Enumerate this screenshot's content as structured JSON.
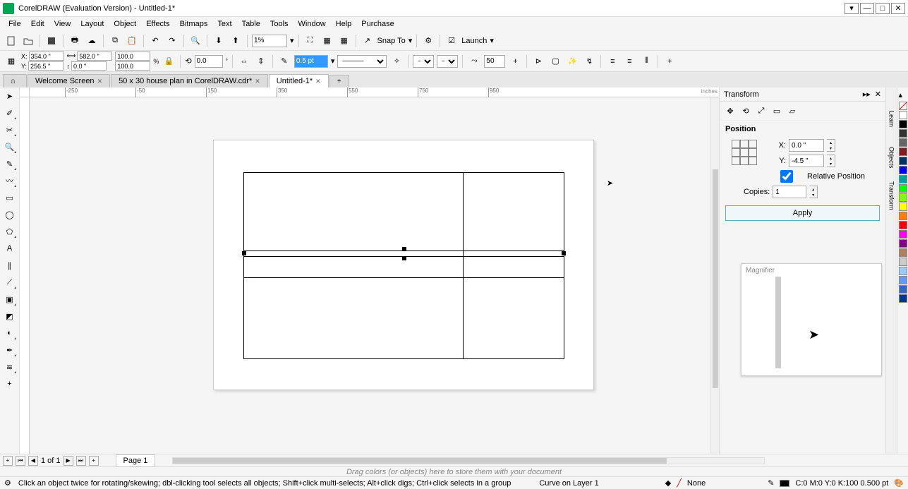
{
  "title": "CorelDRAW (Evaluation Version) - Untitled-1*",
  "menu": [
    "File",
    "Edit",
    "View",
    "Layout",
    "Object",
    "Effects",
    "Bitmaps",
    "Text",
    "Table",
    "Tools",
    "Window",
    "Help",
    "Purchase"
  ],
  "toolbar": {
    "zoom": "1%",
    "snap": "Snap To",
    "launch": "Launch"
  },
  "propbar": {
    "x": "354.0 \"",
    "y": "256.5 \"",
    "w": "582.0 \"",
    "h": "0.0 \"",
    "sx": "100.0",
    "sy": "100.0",
    "rot": "0.0",
    "outline": "0.5 pt",
    "arrow": "50"
  },
  "tabs": [
    {
      "label": "Welcome Screen",
      "active": false
    },
    {
      "label": "50 x 30 house plan in CorelDRAW.cdr*",
      "active": false
    },
    {
      "label": "Untitled-1*",
      "active": true
    }
  ],
  "ruler_h": [
    "-250",
    "-50",
    "150",
    "350",
    "550",
    "750",
    "950"
  ],
  "ruler_h_positions": [
    90,
    190,
    290,
    390,
    490,
    590,
    690
  ],
  "ruler_units": "inches",
  "transform": {
    "title": "Transform",
    "section": "Position",
    "x": "0.0 \"",
    "y": "-4.5 \"",
    "relative": "Relative Position",
    "copies_label": "Copies:",
    "copies": "1",
    "apply": "Apply"
  },
  "magnifier_title": "Magnifier",
  "docker_tabs": [
    "Learn",
    "Objects",
    "Transform"
  ],
  "colors": [
    "#ffffff",
    "#000000",
    "#333333",
    "#666666",
    "#7f1f1f",
    "#003366",
    "#0000ff",
    "#00a0a0",
    "#00ff00",
    "#80ff00",
    "#ffff00",
    "#ff8000",
    "#ff0000",
    "#ff00ff",
    "#800080",
    "#b08060",
    "#cccccc",
    "#99ccff",
    "#6699ff",
    "#3366cc",
    "#003399"
  ],
  "pagebar": {
    "pageof": "1 of 1",
    "page": "Page 1"
  },
  "dragbar": "Drag colors (or objects) here to store them with your document",
  "status": {
    "hint": "Click an object twice for rotating/skewing; dbl-clicking tool selects all objects; Shift+click multi-selects; Alt+click digs; Ctrl+click selects in a group",
    "obj": "Curve on Layer 1",
    "fill": "None",
    "color": "C:0 M:0 Y:0 K:100 0.500 pt"
  }
}
